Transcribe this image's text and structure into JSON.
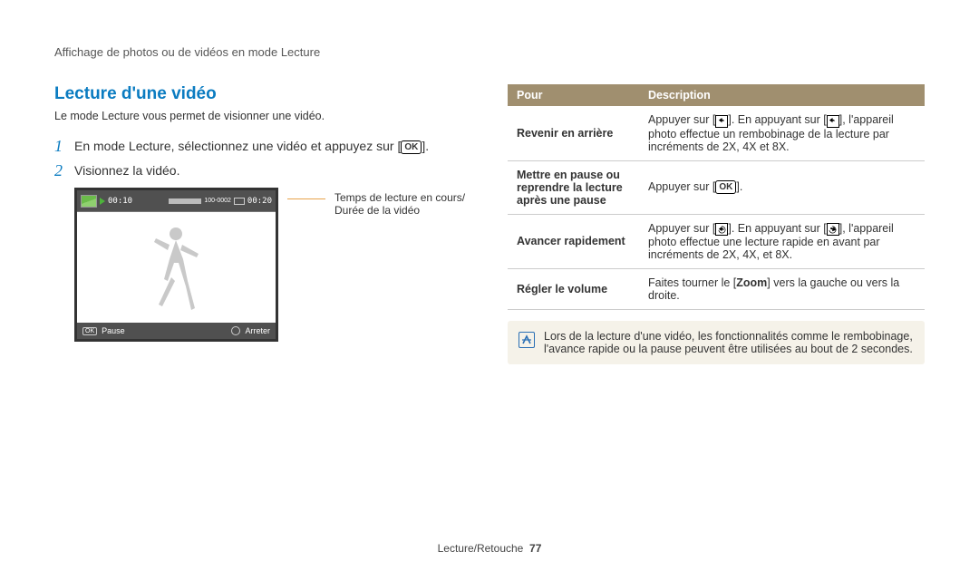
{
  "breadcrumb": "Affichage de photos ou de vidéos en mode Lecture",
  "heading": "Lecture d'une vidéo",
  "intro": "Le mode Lecture vous permet de visionner une vidéo.",
  "steps": [
    {
      "num": "1",
      "text_before": "En mode Lecture, sélectionnez une vidéo et appuyez sur [",
      "ok": "OK",
      "text_after": "]."
    },
    {
      "num": "2",
      "text_before": "Visionnez la vidéo.",
      "ok": "",
      "text_after": ""
    }
  ],
  "camera": {
    "time_current": "00:10",
    "time_total": "00:20",
    "battery": "100-0002",
    "bottom_left_icon": "OK",
    "bottom_left_label": "Pause",
    "bottom_right_label": "Arreter"
  },
  "callout": {
    "line1": "Temps de lecture en cours/",
    "line2": "Durée de la vidéo"
  },
  "table": {
    "headers": [
      "Pour",
      "Description"
    ],
    "rows": [
      {
        "label": "Revenir en arrière",
        "desc_pre": "Appuyer sur [",
        "desc_mid": "]. En appuyant sur [",
        "desc_post": "], l'appareil photo effectue un rembobinage de la lecture par incréments de 2X, 4X et 8X.",
        "icon": "rewind"
      },
      {
        "label": "Mettre en pause ou reprendre la lecture après une pause",
        "desc_pre": "Appuyer sur [",
        "desc_mid": "",
        "desc_post": "].",
        "icon": "ok"
      },
      {
        "label": "Avancer rapidement",
        "desc_pre": "Appuyer sur [",
        "desc_mid": "]. En appuyant sur [",
        "desc_post": "], l'appareil photo effectue une lecture rapide en avant par incréments de 2X, 4X, et 8X.",
        "icon": "forward"
      },
      {
        "label": "Régler le volume",
        "desc_full_pre": "Faites tourner le [",
        "desc_bold": "Zoom",
        "desc_full_post": "] vers la gauche ou vers la droite.",
        "icon": "none"
      }
    ]
  },
  "note": "Lors de la lecture d'une vidéo, les fonctionnalités comme le rembobinage, l'avance rapide ou la pause peuvent être utilisées au bout de 2 secondes.",
  "footer_section": "Lecture/Retouche",
  "footer_page": "77"
}
